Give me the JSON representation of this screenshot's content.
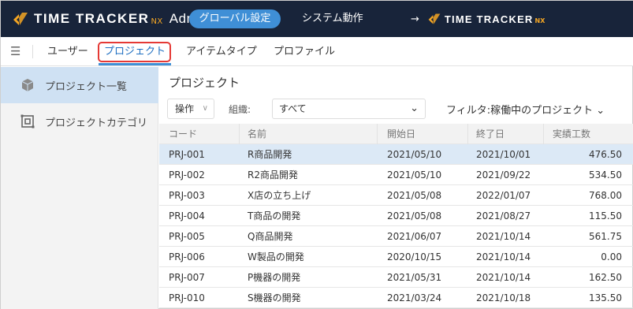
{
  "header": {
    "logo_text": "TIME TRACKER",
    "logo_nx": "NX",
    "app_name": "Admin",
    "nav_global_settings": "グローバル設定",
    "nav_system_ops": "システム動作",
    "link_arrow": "→",
    "link_logo_text": "TIME TRACKER",
    "link_logo_nx": "NX"
  },
  "subnav": {
    "tabs": [
      {
        "label": "ユーザー"
      },
      {
        "label": "プロジェクト"
      },
      {
        "label": "アイテムタイプ"
      },
      {
        "label": "プロファイル"
      }
    ]
  },
  "sidebar": {
    "items": [
      {
        "label": "プロジェクト一覧"
      },
      {
        "label": "プロジェクトカテゴリ"
      }
    ]
  },
  "main": {
    "title": "プロジェクト",
    "ops_label": "操作",
    "org_label": "組織:",
    "org_value": "すべて",
    "filter_label": "フィルタ:稼働中のプロジェクト ⌄"
  },
  "table": {
    "columns": [
      "コード",
      "名前",
      "開始日",
      "終了日",
      "実績工数"
    ],
    "rows": [
      [
        "PRJ-001",
        "R商品開発",
        "2021/05/10",
        "2021/10/01",
        "476.50"
      ],
      [
        "PRJ-002",
        "R2商品開発",
        "2021/05/10",
        "2021/09/22",
        "534.50"
      ],
      [
        "PRJ-003",
        "X店の立ち上げ",
        "2021/05/08",
        "2022/01/07",
        "768.00"
      ],
      [
        "PRJ-004",
        "T商品の開発",
        "2021/05/08",
        "2021/08/27",
        "115.50"
      ],
      [
        "PRJ-005",
        "Q商品開発",
        "2021/06/07",
        "2021/10/14",
        "561.75"
      ],
      [
        "PRJ-006",
        "W製品の開発",
        "2020/10/15",
        "2021/10/14",
        "0.00"
      ],
      [
        "PRJ-007",
        "P機器の開発",
        "2021/05/31",
        "2021/10/14",
        "162.50"
      ],
      [
        "PRJ-010",
        "S機器の開発",
        "2021/03/24",
        "2021/10/18",
        "135.50"
      ]
    ]
  },
  "colors": {
    "header_bg": "#18243a",
    "accent": "#3f8fd6",
    "logo_orange": "#f5a623",
    "highlight_red": "#e53935",
    "selected_row": "#dce9f6",
    "sidebar_active": "#cfe1f3"
  }
}
